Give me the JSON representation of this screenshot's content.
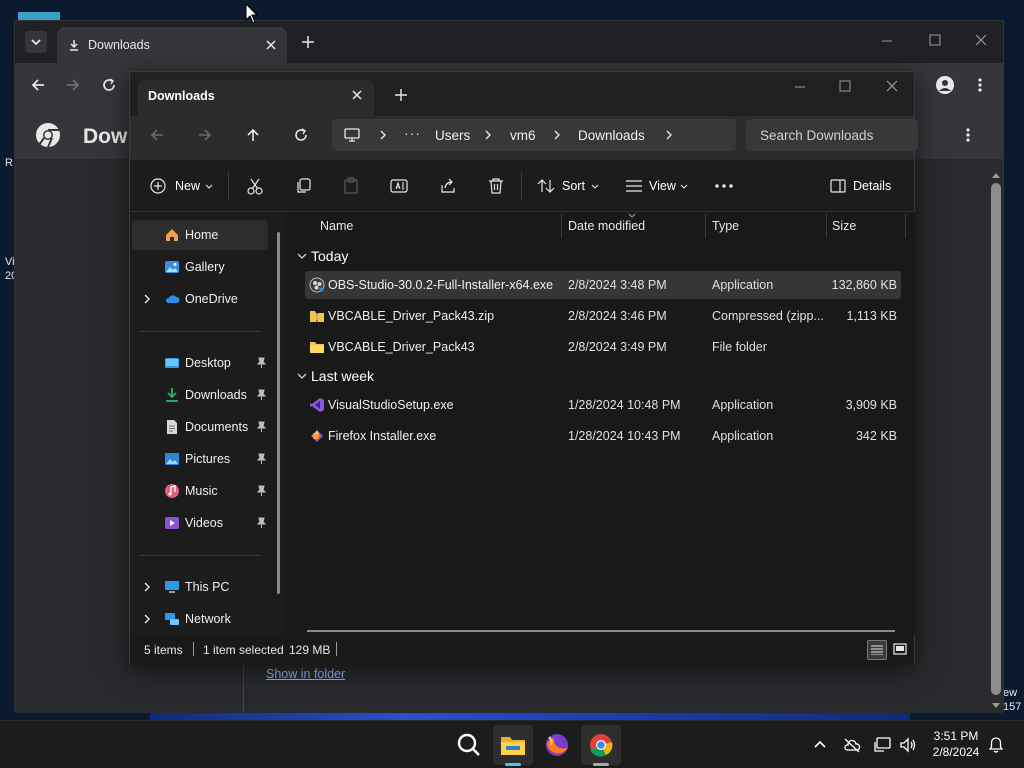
{
  "desktop": {
    "left_text_1": "R",
    "left_text_2": "Vi",
    "left_text_3": "20",
    "right_text_1": "ew",
    "right_text_2": "157"
  },
  "chrome": {
    "tab_title": "Downloads",
    "page_title_partial": "Dow",
    "show_in_folder": "Show in folder"
  },
  "explorer": {
    "tab_title": "Downloads",
    "breadcrumb": [
      "Users",
      "vm6",
      "Downloads"
    ],
    "search_placeholder": "Search Downloads",
    "commands": {
      "new": "New",
      "sort": "Sort",
      "view": "View",
      "details": "Details"
    },
    "sidebar": {
      "home": "Home",
      "gallery": "Gallery",
      "onedrive": "OneDrive",
      "desktop": "Desktop",
      "downloads": "Downloads",
      "documents": "Documents",
      "pictures": "Pictures",
      "music": "Music",
      "videos": "Videos",
      "thispc": "This PC",
      "network": "Network"
    },
    "columns": [
      "Name",
      "Date modified",
      "Type",
      "Size"
    ],
    "groups": [
      {
        "label": "Today",
        "files": [
          {
            "name": "OBS-Studio-30.0.2-Full-Installer-x64.exe",
            "date": "2/8/2024 3:48 PM",
            "type": "Application",
            "size": "132,860 KB"
          },
          {
            "name": "VBCABLE_Driver_Pack43.zip",
            "date": "2/8/2024 3:46 PM",
            "type": "Compressed (zipp...",
            "size": "1,113 KB"
          },
          {
            "name": "VBCABLE_Driver_Pack43",
            "date": "2/8/2024 3:49 PM",
            "type": "File folder",
            "size": ""
          }
        ]
      },
      {
        "label": "Last week",
        "files": [
          {
            "name": "VisualStudioSetup.exe",
            "date": "1/28/2024 10:48 PM",
            "type": "Application",
            "size": "3,909 KB"
          },
          {
            "name": "Firefox Installer.exe",
            "date": "1/28/2024 10:43 PM",
            "type": "Application",
            "size": "342 KB"
          }
        ]
      }
    ],
    "status": {
      "items": "5 items",
      "selected": "1 item selected",
      "size": "129 MB"
    }
  },
  "taskbar": {
    "time": "3:51 PM",
    "date": "2/8/2024"
  },
  "colors": {
    "accent": "#4cc2ff",
    "folder": "#f5c542",
    "selection": "#363636"
  }
}
